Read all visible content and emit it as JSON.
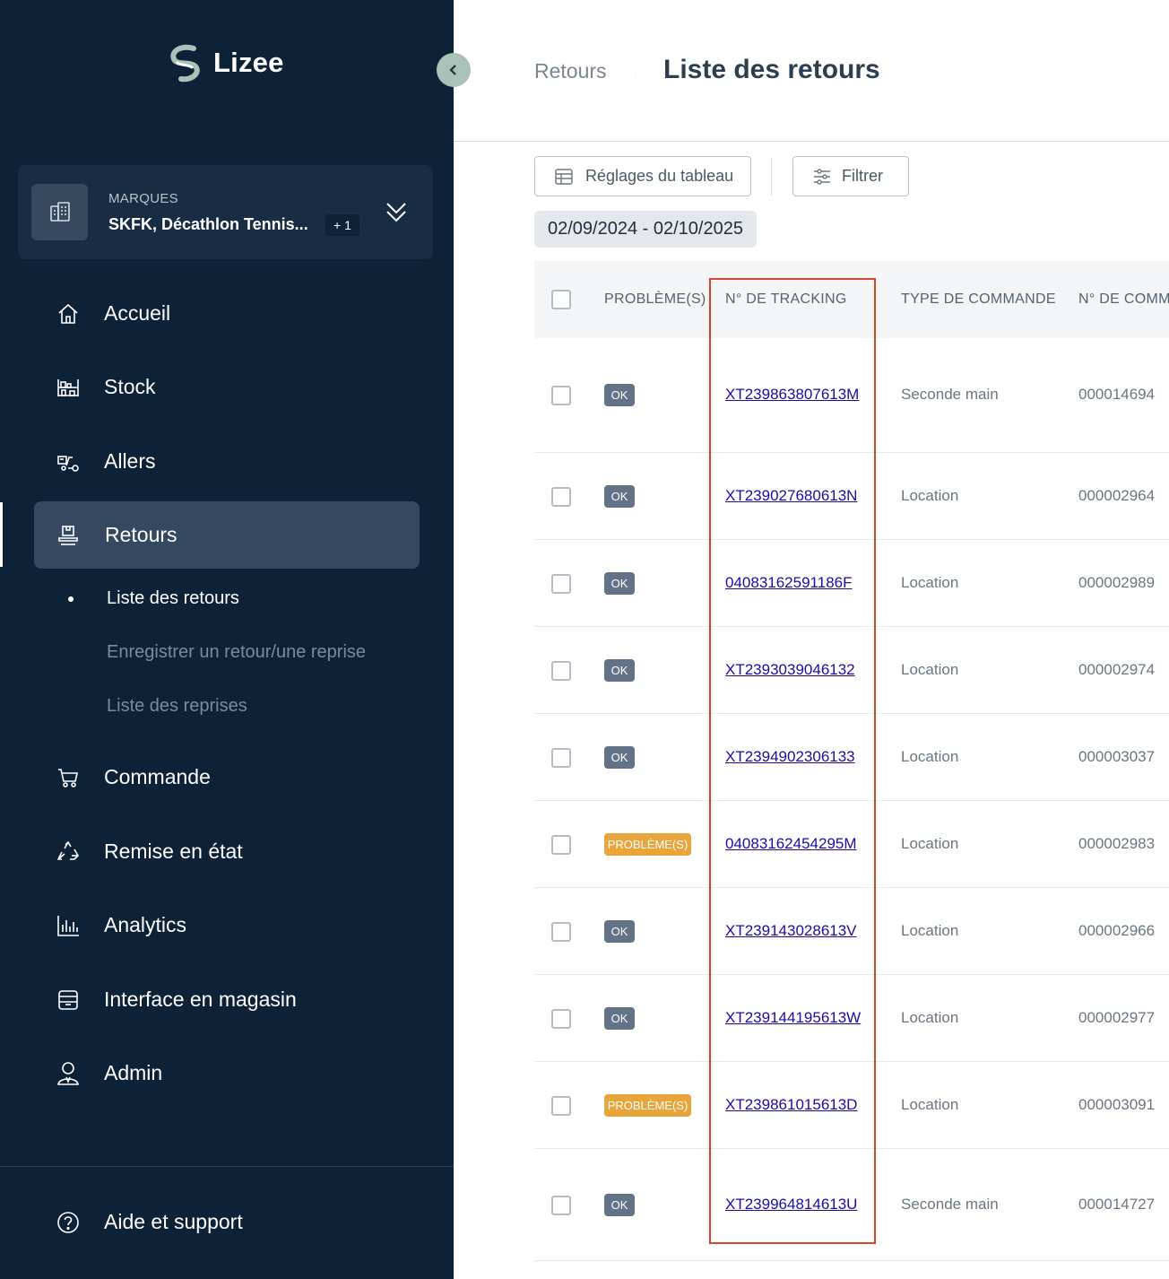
{
  "brand": {
    "logo_text": "Lizee"
  },
  "brand_selector": {
    "label": "MARQUES",
    "value": "SKFK, Décathlon Tennis...",
    "more": "+ 1"
  },
  "nav": {
    "accueil": "Accueil",
    "stock": "Stock",
    "allers": "Allers",
    "retours": "Retours",
    "commande": "Commande",
    "remise": "Remise en état",
    "analytics": "Analytics",
    "magasin": "Interface en magasin",
    "admin": "Admin",
    "aide": "Aide et support"
  },
  "subnav": {
    "liste_retours": "Liste des retours",
    "enregistrer": "Enregistrer un retour/une reprise",
    "liste_reprises": "Liste des reprises"
  },
  "header": {
    "breadcrumb": "Retours",
    "title": "Liste des retours"
  },
  "toolbar": {
    "settings_label": "Réglages du tableau",
    "filter_label": "Filtrer",
    "date_range": "02/09/2024 - 02/10/2025"
  },
  "table": {
    "headers": {
      "problems": "PROBLÈME(S)",
      "tracking": "N° DE TRACKING",
      "order_type": "TYPE DE COMMANDE",
      "order_number": "N° DE COMMA"
    },
    "rows": [
      {
        "status": "OK",
        "tracking": "XT239863807613M",
        "type": "Seconde main",
        "order": "000014694"
      },
      {
        "status": "OK",
        "tracking": "XT239027680613N",
        "type": "Location",
        "order": "000002964"
      },
      {
        "status": "OK",
        "tracking": "04083162591186F",
        "type": "Location",
        "order": "000002989"
      },
      {
        "status": "OK",
        "tracking": "XT2393039046132",
        "type": "Location",
        "order": "000002974"
      },
      {
        "status": "OK",
        "tracking": "XT2394902306133",
        "type": "Location",
        "order": "000003037"
      },
      {
        "status": "PROBLÈME(S)",
        "tracking": "04083162454295M",
        "type": "Location",
        "order": "000002983"
      },
      {
        "status": "OK",
        "tracking": "XT239143028613V",
        "type": "Location",
        "order": "000002966"
      },
      {
        "status": "OK",
        "tracking": "XT239144195613W",
        "type": "Location",
        "order": "000002977"
      },
      {
        "status": "PROBLÈME(S)",
        "tracking": "XT239861015613D",
        "type": "Location",
        "order": "000003091"
      },
      {
        "status": "OK",
        "tracking": "XT239964814613U",
        "type": "Seconde main",
        "order": "000014727"
      }
    ]
  },
  "colors": {
    "sidebar": "#0d2137",
    "active_nav": "#34495f",
    "ok_badge": "#637286",
    "problem_badge": "#e8a53a",
    "highlight": "#d9442e",
    "link": "#1a0dab"
  }
}
